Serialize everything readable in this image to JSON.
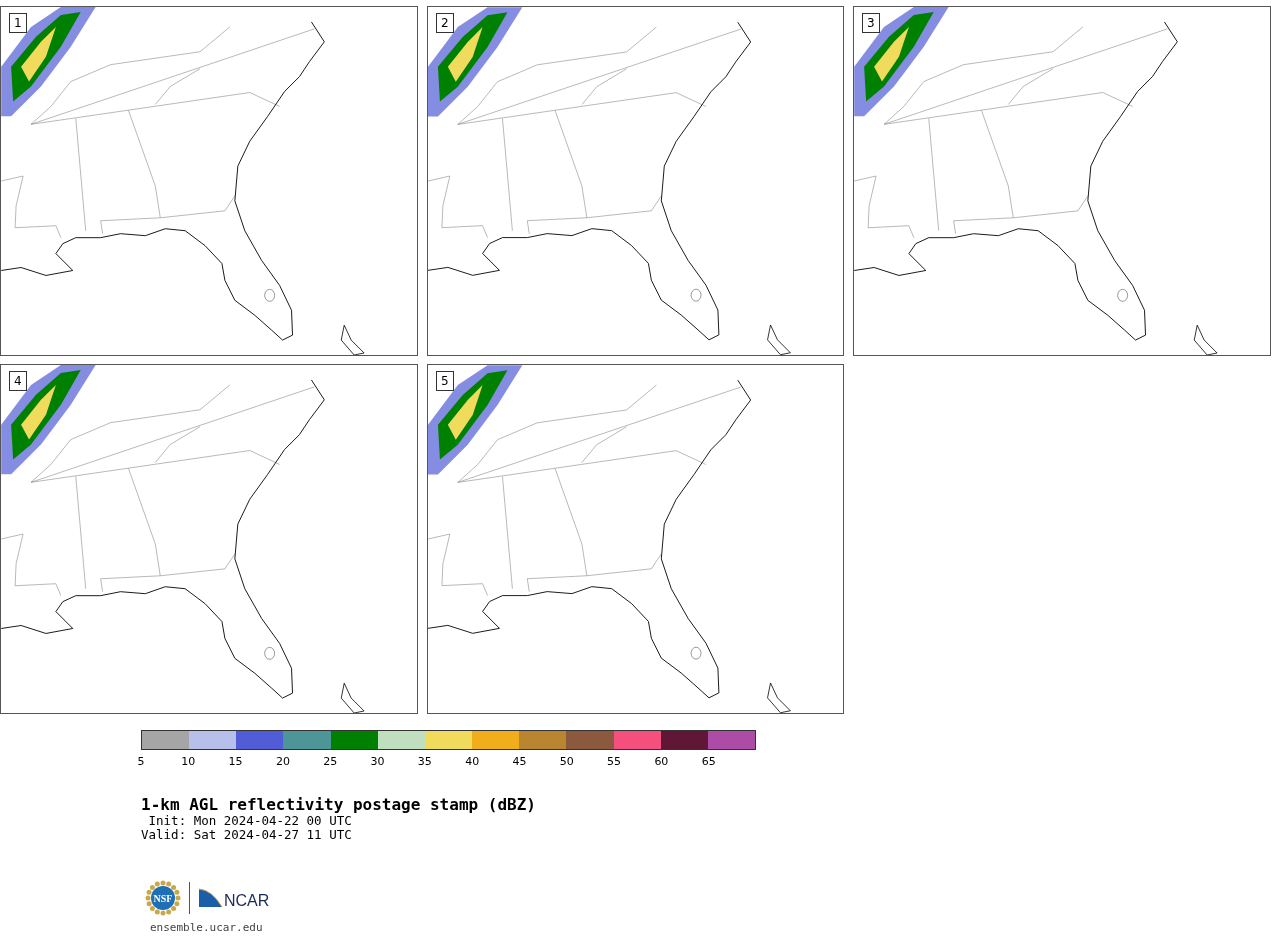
{
  "panels": [
    {
      "label": "1"
    },
    {
      "label": "2"
    },
    {
      "label": "3"
    },
    {
      "label": "4"
    },
    {
      "label": "5"
    }
  ],
  "colorbar": {
    "segments": [
      {
        "color": "#a5a5a5"
      },
      {
        "color": "#b7c0ea"
      },
      {
        "color": "#515dd6"
      },
      {
        "color": "#4e9598"
      },
      {
        "color": "#008000"
      },
      {
        "color": "#bfdfbf"
      },
      {
        "color": "#f0db5c"
      },
      {
        "color": "#f0ae1a"
      },
      {
        "color": "#b98530"
      },
      {
        "color": "#8b5a3e"
      },
      {
        "color": "#f44f7d"
      },
      {
        "color": "#5f1735"
      },
      {
        "color": "#ad4ca7"
      }
    ],
    "ticks": [
      "5",
      "10",
      "15",
      "20",
      "25",
      "30",
      "35",
      "40",
      "45",
      "50",
      "55",
      "60",
      "65"
    ]
  },
  "title": "1-km AGL reflectivity postage stamp (dBZ)",
  "init": " Init: Mon 2024-04-22 00 UTC",
  "valid": "Valid: Sat 2024-04-27 11 UTC",
  "logos": {
    "nsf": "NSF",
    "ncar": "NCAR"
  },
  "url": "ensemble.ucar.edu"
}
